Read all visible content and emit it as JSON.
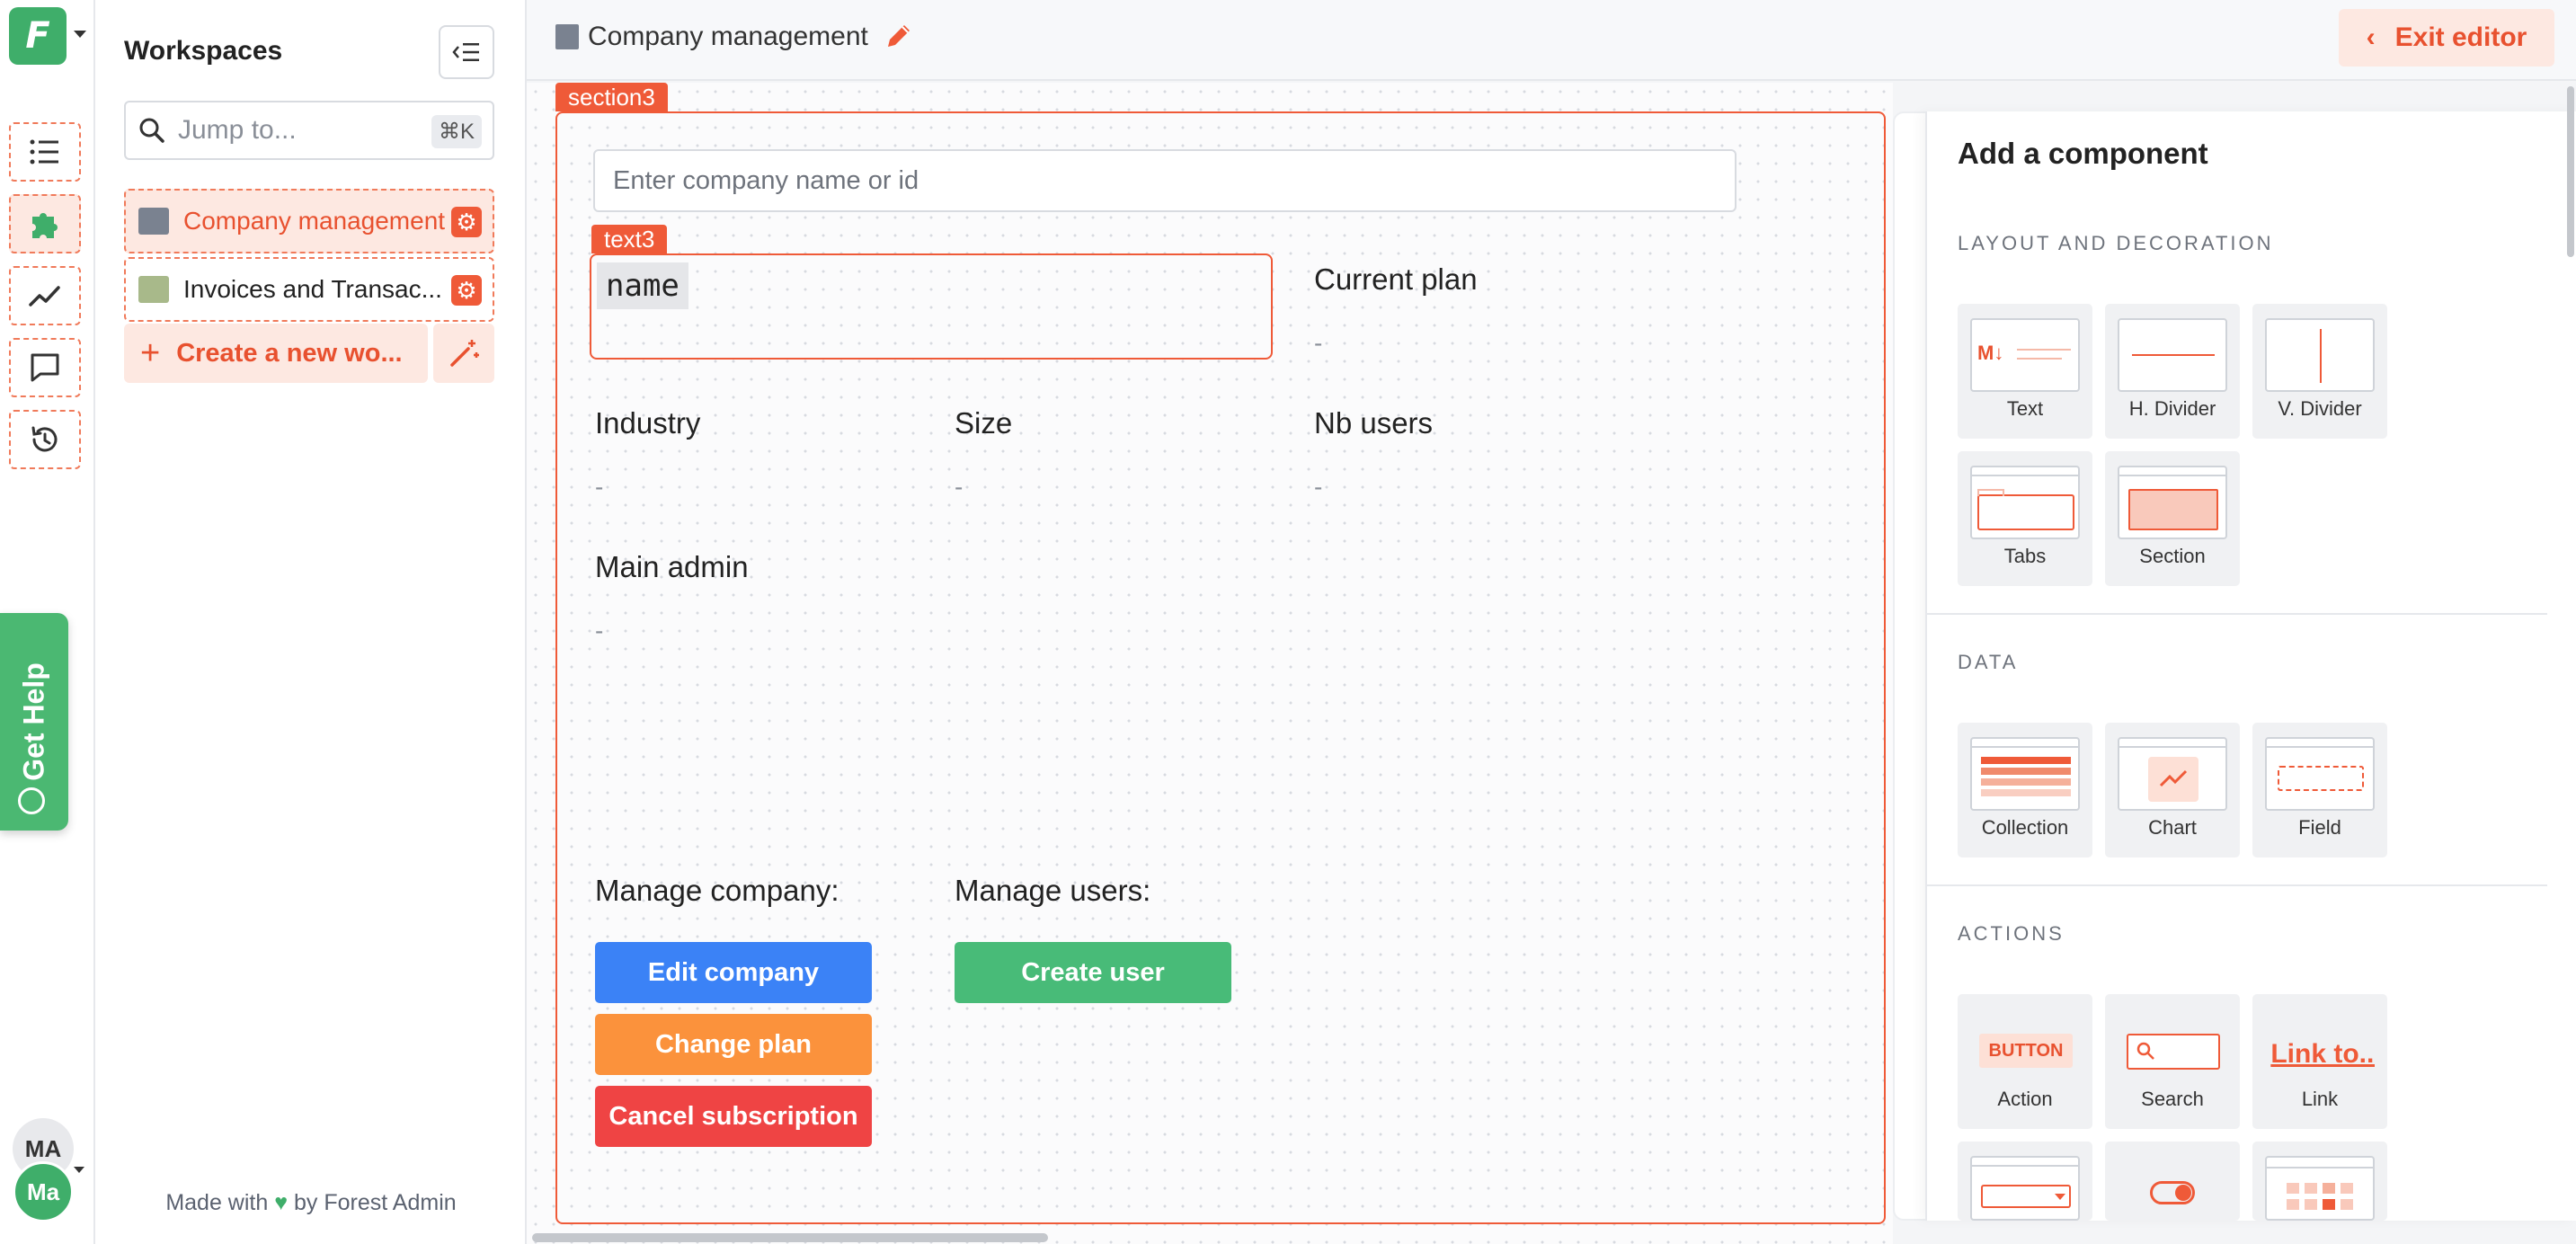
{
  "app": {
    "logo_letter": "F",
    "brand_color": "#3fae6a",
    "accent_color": "#ef5a38"
  },
  "rail": {
    "icons": [
      "list-icon",
      "puzzle-icon",
      "chart-line-icon",
      "comment-icon",
      "history-icon"
    ],
    "get_help": "Get Help",
    "user_initials": "MA",
    "user_avatar": "Ma"
  },
  "workspaces": {
    "title": "Workspaces",
    "search_placeholder": "Jump to...",
    "search_shortcut": "⌘K",
    "items": [
      {
        "label": "Company management",
        "active": true
      },
      {
        "label": "Invoices and Transac..."
      }
    ],
    "create_label": "Create a new wo...",
    "footer_prefix": "Made with",
    "footer_suffix": "by Forest Admin"
  },
  "topbar": {
    "title": "Company management",
    "exit_label": "Exit editor"
  },
  "editor": {
    "section_tag": "section3",
    "company_placeholder": "Enter company name or id",
    "text_tag": "text3",
    "text_value": "name",
    "fields": {
      "current_plan": {
        "label": "Current plan",
        "value": "-"
      },
      "industry": {
        "label": "Industry",
        "value": "-"
      },
      "size": {
        "label": "Size",
        "value": "-"
      },
      "nb_users": {
        "label": "Nb users",
        "value": "-"
      },
      "main_admin": {
        "label": "Main admin",
        "value": "-"
      }
    },
    "manage_company_label": "Manage company:",
    "manage_users_label": "Manage users:",
    "buttons": {
      "edit_company": "Edit company",
      "change_plan": "Change plan",
      "cancel_subscription": "Cancel subscription",
      "create_user": "Create user"
    },
    "button_colors": {
      "edit": "#3b82f6",
      "change": "#fb923c",
      "cancel": "#ef4444",
      "create": "#48bb78"
    }
  },
  "panel": {
    "title": "Add a component",
    "categories": {
      "layout": "LAYOUT AND DECORATION",
      "data": "DATA",
      "actions": "ACTIONS"
    },
    "layout_items": [
      "Text",
      "H. Divider",
      "V. Divider",
      "Tabs",
      "Section"
    ],
    "data_items": [
      "Collection",
      "Chart",
      "Field"
    ],
    "action_items": [
      "Action",
      "Search",
      "Link"
    ],
    "action_thumb_text": {
      "button": "BUTTON",
      "link": "Link to..."
    },
    "text_thumb": "M↓"
  }
}
